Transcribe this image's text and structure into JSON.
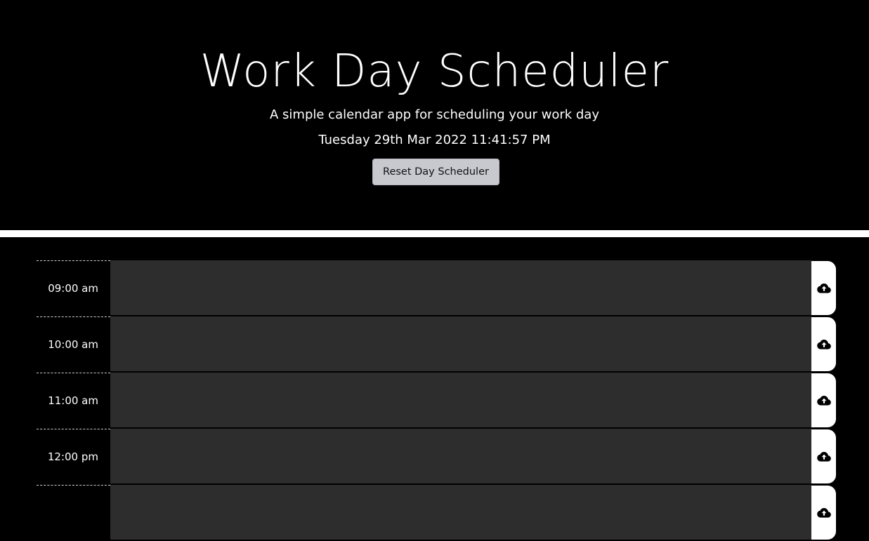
{
  "header": {
    "title": "Work Day Scheduler",
    "subtitle": "A simple calendar app for scheduling your work day",
    "current_day": "Tuesday 29th Mar 2022 11:41:57 PM",
    "reset_label": "Reset Day Scheduler"
  },
  "schedule": {
    "rows": [
      {
        "hour": "09:00 am",
        "text": "",
        "save_icon": "cloud-upload-icon"
      },
      {
        "hour": "10:00 am",
        "text": "",
        "save_icon": "cloud-upload-icon"
      },
      {
        "hour": "11:00 am",
        "text": "",
        "save_icon": "cloud-upload-icon"
      },
      {
        "hour": "12:00 pm",
        "text": "",
        "save_icon": "cloud-upload-icon"
      },
      {
        "hour": "",
        "text": "",
        "save_icon": "cloud-upload-icon"
      }
    ]
  },
  "colors": {
    "background": "#000000",
    "row_background": "#2d2d2d",
    "save_button": "#ffffff",
    "reset_button": "#c7c9cf"
  }
}
